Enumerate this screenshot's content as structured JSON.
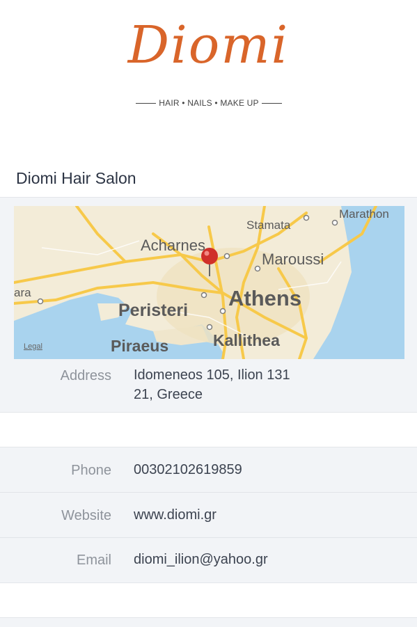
{
  "logo": {
    "name": "Diomi",
    "tagline": "HAIR • NAILS • MAKE UP"
  },
  "salon": {
    "title": "Diomi Hair Salon"
  },
  "map": {
    "places": [
      "Marathon",
      "Stamata",
      "Acharnes",
      "Maroussi",
      "ara",
      "Athens",
      "Peristeri",
      "Piraeus",
      "Kallithea"
    ],
    "legal": "Legal"
  },
  "address": {
    "label": "Address",
    "line1": "Idomeneos 105, Ilion 131",
    "line2": "21, Greece"
  },
  "phone": {
    "label": "Phone",
    "value": "00302102619859"
  },
  "website": {
    "label": "Website",
    "value": "www.diomi.gr"
  },
  "email": {
    "label": "Email",
    "value": "diomi_ilion@yahoo.gr"
  },
  "colors": {
    "brand": "#d9652a",
    "panel": "#f2f4f7",
    "water": "#a9d3ee",
    "land": "#f3ecd8",
    "road": "#f7c94a",
    "pin": "#d0302a"
  }
}
